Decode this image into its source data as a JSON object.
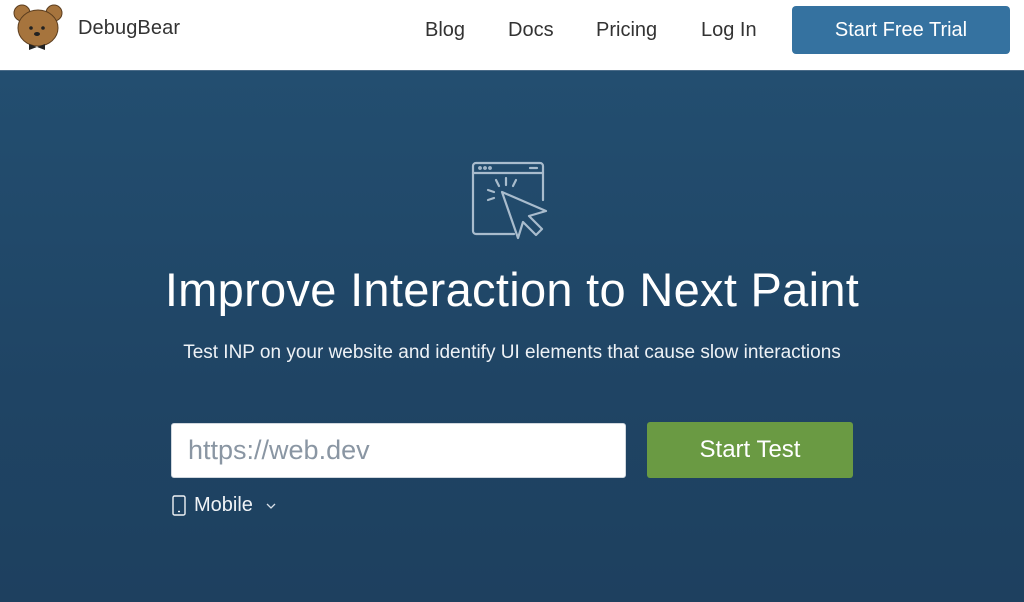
{
  "header": {
    "brand": "DebugBear",
    "nav": [
      {
        "label": "Blog"
      },
      {
        "label": "Docs"
      },
      {
        "label": "Pricing"
      },
      {
        "label": "Log In"
      }
    ],
    "cta_label": "Start Free Trial"
  },
  "hero": {
    "icon": "browser-click-icon",
    "title": "Improve Interaction to Next Paint",
    "subtitle": "Test INP on your website and identify UI elements that cause slow interactions",
    "url_input": {
      "value": "",
      "placeholder": "https://web.dev"
    },
    "submit_label": "Start Test",
    "device_select": {
      "selected": "Mobile",
      "icon": "mobile-phone-icon"
    }
  },
  "colors": {
    "brand_blue": "#3572a0",
    "hero_bg": "#214a6b",
    "start_test_green": "#6a9a43"
  }
}
